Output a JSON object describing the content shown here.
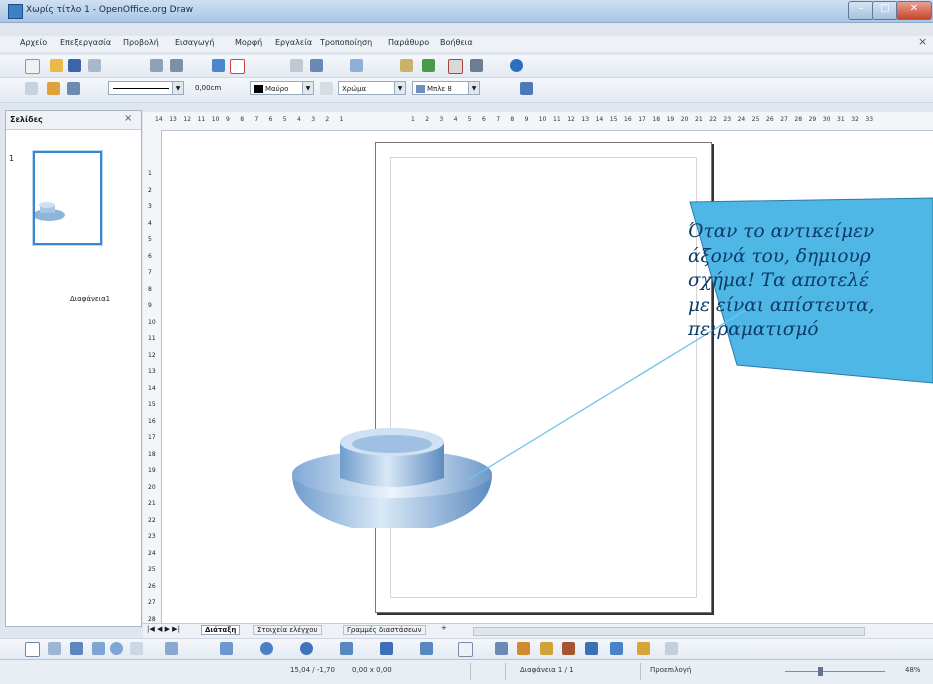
{
  "window": {
    "title": "Χωρίς τίτλο 1 - OpenOffice.org Draw"
  },
  "window_buttons": {
    "minimize": "–",
    "maximize": "□",
    "close": "✕"
  },
  "menu": [
    "Αρχείο",
    "Επεξεργασία",
    "Προβολή",
    "Εισαγωγή",
    "Μορφή",
    "Εργαλεία",
    "Τροποποίηση",
    "Παράθυρο",
    "Βοήθεια"
  ],
  "menu_close": "×",
  "line_toolbar": {
    "line_width": "0,00cm",
    "area_color": "Μαύρο",
    "area_style": "Χρώμα",
    "area_value": "Μπλε 8"
  },
  "slides_panel": {
    "title": "Σελίδες",
    "close": "×",
    "thumb_number": "1",
    "thumb_label": "Διαφάνεια1"
  },
  "ruler": {
    "left_ticks": [
      "14",
      "13",
      "12",
      "11",
      "10",
      "9",
      "8",
      "7",
      "6",
      "5",
      "4",
      "3",
      "2",
      "1"
    ],
    "right_ticks": [
      "1",
      "2",
      "3",
      "4",
      "5",
      "6",
      "7",
      "8",
      "9",
      "10",
      "11",
      "12",
      "13",
      "14",
      "15",
      "16",
      "17",
      "18",
      "19",
      "20",
      "21",
      "22",
      "23",
      "24",
      "25",
      "26",
      "27",
      "28",
      "29",
      "30",
      "31",
      "32",
      "33"
    ],
    "vertical_ticks": [
      "1",
      "2",
      "3",
      "4",
      "5",
      "6",
      "7",
      "8",
      "9",
      "10",
      "11",
      "12",
      "13",
      "14",
      "15",
      "16",
      "17",
      "18",
      "19",
      "20",
      "21",
      "22",
      "23",
      "24",
      "25",
      "26",
      "27",
      "28"
    ]
  },
  "callout": {
    "lines": [
      "Όταν το αντικείμεν",
      "άξονά του, δημιουρ",
      "σχήμα! Τα αποτελέ",
      "με είναι απίστευτα,",
      "πειραματισμό"
    ],
    "fill": "#4fb7e6",
    "text_color": "#0d3a66"
  },
  "tabs": {
    "nav": "|◀ ◀ ▶ ▶|",
    "items": [
      "Διάταξη",
      "Στοιχεία ελέγχου",
      "Γραμμές διαστάσεων"
    ],
    "add": "+"
  },
  "status": {
    "position": "15,04 / -1,70",
    "size": "0,00 x 0,00",
    "slide": "Διαφάνεια 1 / 1",
    "layout": "Προεπιλογή",
    "zoom": "48%"
  }
}
